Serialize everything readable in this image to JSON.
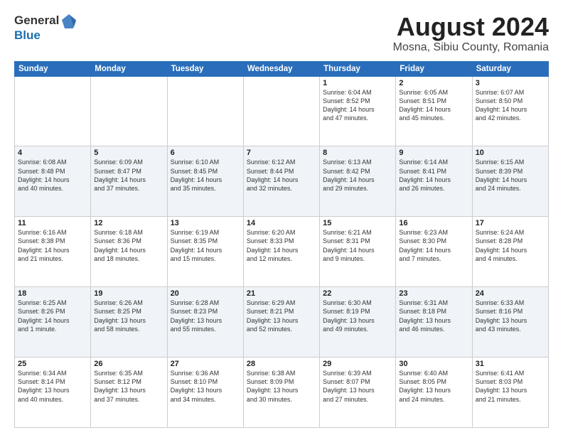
{
  "header": {
    "logo_general": "General",
    "logo_blue": "Blue",
    "main_title": "August 2024",
    "subtitle": "Mosna, Sibiu County, Romania"
  },
  "weekdays": [
    "Sunday",
    "Monday",
    "Tuesday",
    "Wednesday",
    "Thursday",
    "Friday",
    "Saturday"
  ],
  "weeks": [
    {
      "days": [
        {
          "num": "",
          "info": ""
        },
        {
          "num": "",
          "info": ""
        },
        {
          "num": "",
          "info": ""
        },
        {
          "num": "",
          "info": ""
        },
        {
          "num": "1",
          "info": "Sunrise: 6:04 AM\nSunset: 8:52 PM\nDaylight: 14 hours\nand 47 minutes."
        },
        {
          "num": "2",
          "info": "Sunrise: 6:05 AM\nSunset: 8:51 PM\nDaylight: 14 hours\nand 45 minutes."
        },
        {
          "num": "3",
          "info": "Sunrise: 6:07 AM\nSunset: 8:50 PM\nDaylight: 14 hours\nand 42 minutes."
        }
      ]
    },
    {
      "days": [
        {
          "num": "4",
          "info": "Sunrise: 6:08 AM\nSunset: 8:48 PM\nDaylight: 14 hours\nand 40 minutes."
        },
        {
          "num": "5",
          "info": "Sunrise: 6:09 AM\nSunset: 8:47 PM\nDaylight: 14 hours\nand 37 minutes."
        },
        {
          "num": "6",
          "info": "Sunrise: 6:10 AM\nSunset: 8:45 PM\nDaylight: 14 hours\nand 35 minutes."
        },
        {
          "num": "7",
          "info": "Sunrise: 6:12 AM\nSunset: 8:44 PM\nDaylight: 14 hours\nand 32 minutes."
        },
        {
          "num": "8",
          "info": "Sunrise: 6:13 AM\nSunset: 8:42 PM\nDaylight: 14 hours\nand 29 minutes."
        },
        {
          "num": "9",
          "info": "Sunrise: 6:14 AM\nSunset: 8:41 PM\nDaylight: 14 hours\nand 26 minutes."
        },
        {
          "num": "10",
          "info": "Sunrise: 6:15 AM\nSunset: 8:39 PM\nDaylight: 14 hours\nand 24 minutes."
        }
      ]
    },
    {
      "days": [
        {
          "num": "11",
          "info": "Sunrise: 6:16 AM\nSunset: 8:38 PM\nDaylight: 14 hours\nand 21 minutes."
        },
        {
          "num": "12",
          "info": "Sunrise: 6:18 AM\nSunset: 8:36 PM\nDaylight: 14 hours\nand 18 minutes."
        },
        {
          "num": "13",
          "info": "Sunrise: 6:19 AM\nSunset: 8:35 PM\nDaylight: 14 hours\nand 15 minutes."
        },
        {
          "num": "14",
          "info": "Sunrise: 6:20 AM\nSunset: 8:33 PM\nDaylight: 14 hours\nand 12 minutes."
        },
        {
          "num": "15",
          "info": "Sunrise: 6:21 AM\nSunset: 8:31 PM\nDaylight: 14 hours\nand 9 minutes."
        },
        {
          "num": "16",
          "info": "Sunrise: 6:23 AM\nSunset: 8:30 PM\nDaylight: 14 hours\nand 7 minutes."
        },
        {
          "num": "17",
          "info": "Sunrise: 6:24 AM\nSunset: 8:28 PM\nDaylight: 14 hours\nand 4 minutes."
        }
      ]
    },
    {
      "days": [
        {
          "num": "18",
          "info": "Sunrise: 6:25 AM\nSunset: 8:26 PM\nDaylight: 14 hours\nand 1 minute."
        },
        {
          "num": "19",
          "info": "Sunrise: 6:26 AM\nSunset: 8:25 PM\nDaylight: 13 hours\nand 58 minutes."
        },
        {
          "num": "20",
          "info": "Sunrise: 6:28 AM\nSunset: 8:23 PM\nDaylight: 13 hours\nand 55 minutes."
        },
        {
          "num": "21",
          "info": "Sunrise: 6:29 AM\nSunset: 8:21 PM\nDaylight: 13 hours\nand 52 minutes."
        },
        {
          "num": "22",
          "info": "Sunrise: 6:30 AM\nSunset: 8:19 PM\nDaylight: 13 hours\nand 49 minutes."
        },
        {
          "num": "23",
          "info": "Sunrise: 6:31 AM\nSunset: 8:18 PM\nDaylight: 13 hours\nand 46 minutes."
        },
        {
          "num": "24",
          "info": "Sunrise: 6:33 AM\nSunset: 8:16 PM\nDaylight: 13 hours\nand 43 minutes."
        }
      ]
    },
    {
      "days": [
        {
          "num": "25",
          "info": "Sunrise: 6:34 AM\nSunset: 8:14 PM\nDaylight: 13 hours\nand 40 minutes."
        },
        {
          "num": "26",
          "info": "Sunrise: 6:35 AM\nSunset: 8:12 PM\nDaylight: 13 hours\nand 37 minutes."
        },
        {
          "num": "27",
          "info": "Sunrise: 6:36 AM\nSunset: 8:10 PM\nDaylight: 13 hours\nand 34 minutes."
        },
        {
          "num": "28",
          "info": "Sunrise: 6:38 AM\nSunset: 8:09 PM\nDaylight: 13 hours\nand 30 minutes."
        },
        {
          "num": "29",
          "info": "Sunrise: 6:39 AM\nSunset: 8:07 PM\nDaylight: 13 hours\nand 27 minutes."
        },
        {
          "num": "30",
          "info": "Sunrise: 6:40 AM\nSunset: 8:05 PM\nDaylight: 13 hours\nand 24 minutes."
        },
        {
          "num": "31",
          "info": "Sunrise: 6:41 AM\nSunset: 8:03 PM\nDaylight: 13 hours\nand 21 minutes."
        }
      ]
    }
  ]
}
